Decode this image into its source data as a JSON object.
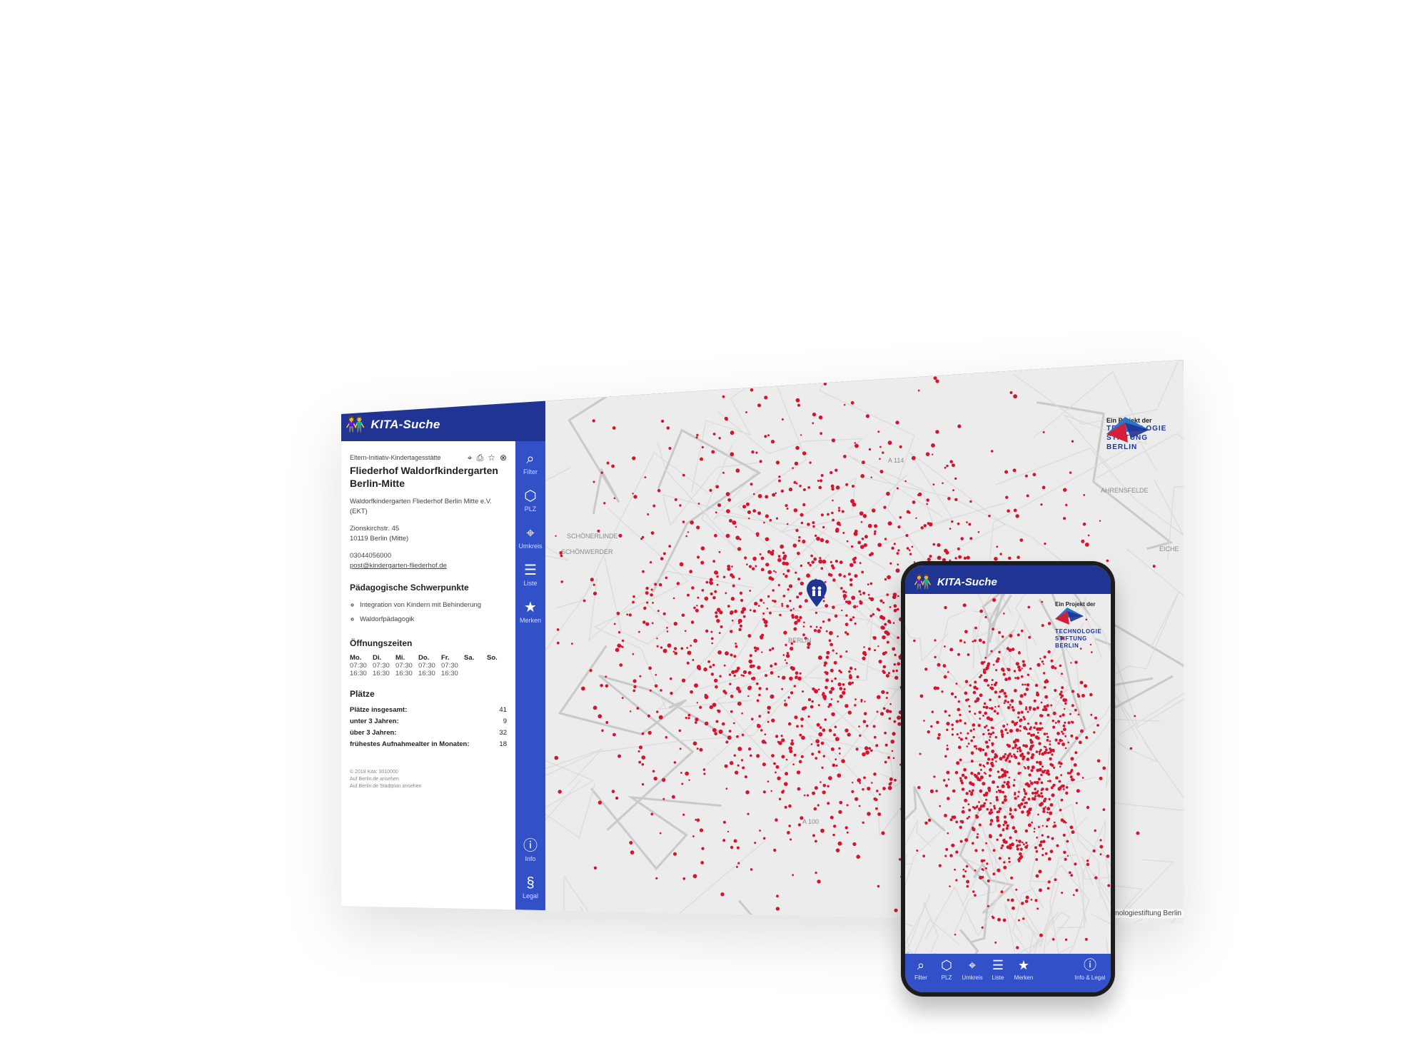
{
  "app": {
    "title": "KITA-Suche",
    "logo": "kita-children-icon"
  },
  "detail": {
    "type": "Eltern-Initiativ-Kindertagesstätte",
    "name": "Fliederhof Waldorfkindergarten Berlin-Mitte",
    "operator": "Waldorfkindergarten Fliederhof Berlin Mitte e.V. (EKT)",
    "street": "Zionskirchstr. 45",
    "city": "10119 Berlin (Mitte)",
    "phone": "03044056000",
    "email": "post@kindergarten-fliederhof.de",
    "focus_title": "Pädagogische Schwerpunkte",
    "focus_items": [
      "Integration von Kindern mit Behinderung",
      "Waldorfpädagogik"
    ],
    "hours_title": "Öffnungszeiten",
    "hours_days": [
      "Mo.",
      "Di.",
      "Mi.",
      "Do.",
      "Fr.",
      "Sa.",
      "So."
    ],
    "hours_open": [
      "07:30",
      "07:30",
      "07:30",
      "07:30",
      "07:30",
      "",
      ""
    ],
    "hours_close": [
      "16:30",
      "16:30",
      "16:30",
      "16:30",
      "16:30",
      "",
      ""
    ],
    "places_title": "Plätze",
    "places": [
      {
        "label": "Plätze insgesamt:",
        "value": "41"
      },
      {
        "label": "unter 3 Jahren:",
        "value": "9"
      },
      {
        "label": "über 3 Jahren:",
        "value": "32"
      },
      {
        "label": "frühestes Aufnahmealter in Monaten:",
        "value": "18"
      }
    ],
    "footnote": [
      "© 2018 Kita: 3010000",
      "Auf Berlin.de ansehen",
      "Auf Berlin.de Stadtplan ansehen"
    ],
    "actions": [
      "location-pin-icon",
      "print-icon",
      "star-icon",
      "close-icon"
    ]
  },
  "rail": [
    {
      "label": "Filter",
      "icon": "search-icon"
    },
    {
      "label": "PLZ",
      "icon": "berlin-map-icon"
    },
    {
      "label": "Umkreis",
      "icon": "location-pin-icon"
    },
    {
      "label": "Liste",
      "icon": "list-icon"
    },
    {
      "label": "Merken",
      "icon": "star-icon"
    },
    {
      "label": "Info",
      "icon": "info-icon"
    },
    {
      "label": "Legal",
      "icon": "paragraph-icon"
    }
  ],
  "map": {
    "partner_intro": "Ein Projekt der",
    "partner_lines": [
      "TECHNOLOGIE",
      "STIFTUNG",
      "BERLIN"
    ],
    "labels": [
      "A 114",
      "BERLIN",
      "AHRENSFELDE",
      "EICHE",
      "A 100",
      "SCHÖNERLINDE",
      "SCHÖNWERDER"
    ],
    "attribution": "Technologiestiftung Berlin",
    "dot_color": "#d5142f"
  },
  "phone": {
    "title": "KITA-Suche",
    "partner_intro": "Ein Projekt der",
    "partner_lines": [
      "TECHNOLOGIE",
      "STIFTUNG",
      "BERLIN"
    ],
    "nav": [
      {
        "label": "Filter",
        "icon": "search-icon"
      },
      {
        "label": "PLZ",
        "icon": "berlin-map-icon"
      },
      {
        "label": "Umkreis",
        "icon": "location-pin-icon"
      },
      {
        "label": "Liste",
        "icon": "list-icon"
      },
      {
        "label": "Merken",
        "icon": "star-icon"
      },
      {
        "label": "Info & Legal",
        "icon": "info-icon"
      }
    ]
  }
}
